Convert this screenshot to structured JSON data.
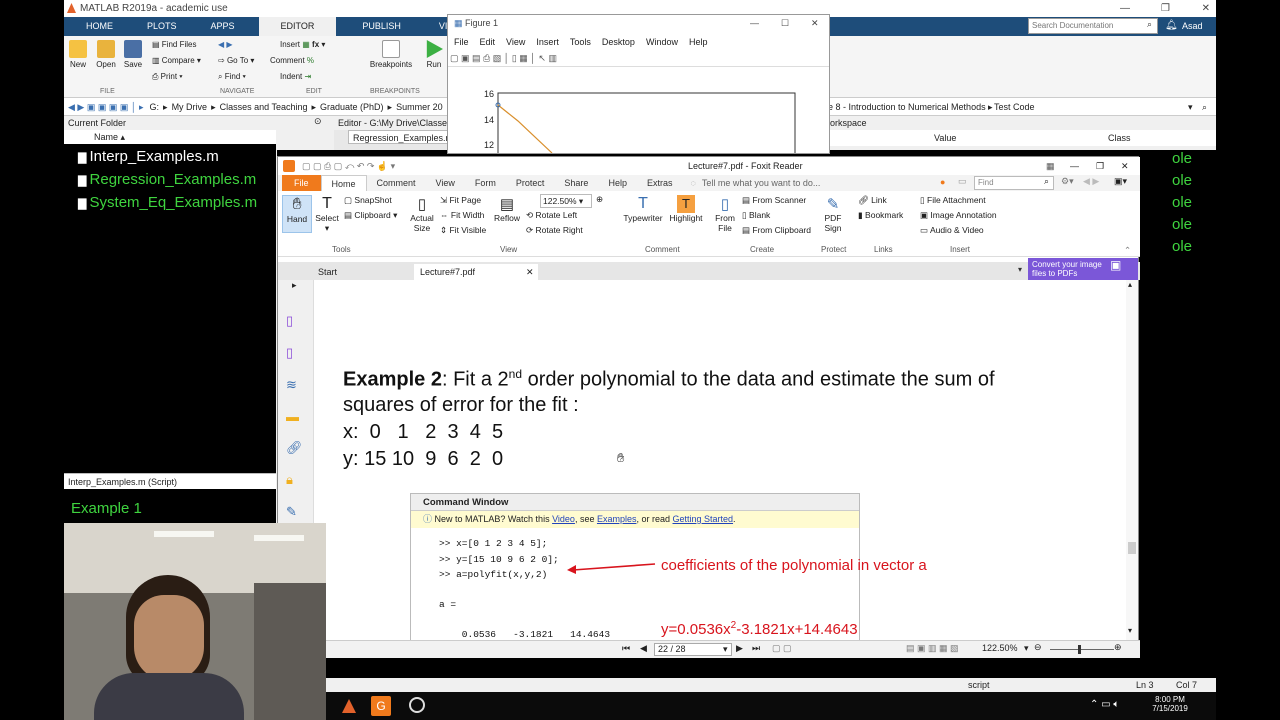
{
  "matlab": {
    "title": "MATLAB R2019a - academic use",
    "tabs": [
      "HOME",
      "PLOTS",
      "APPS",
      "EDITOR",
      "PUBLISH",
      "VIEW"
    ],
    "ribbon": {
      "new": "New",
      "open": "Open",
      "save": "Save",
      "find_files": "Find Files",
      "compare": "Compare",
      "print": "Print",
      "go_to": "Go To",
      "find": "Find",
      "insert": "Insert",
      "comment": "Comment",
      "indent": "Indent",
      "fx": "fx",
      "breakpoints": "Breakpoints",
      "run": "Run",
      "group_file": "FILE",
      "group_navigate": "NAVIGATE",
      "group_edit": "EDIT",
      "group_breakpoints": "BREAKPOINTS"
    },
    "search_placeholder": "Search Documentation",
    "user": "Asad",
    "address": [
      "G:",
      "My Drive",
      "Classes and Teaching",
      "Graduate (PhD)",
      "Summer 20"
    ],
    "address_right": [
      "e 8 - Introduction to Numerical Methods",
      "Test Code"
    ],
    "current_folder": {
      "title": "Current Folder",
      "col_name": "Name ▴",
      "files": [
        "Interp_Examples.m",
        "Regression_Examples.m",
        "System_Eq_Examples.m"
      ]
    },
    "status_file": "Interp_Examples.m  (Script)",
    "example_label": "Example 1",
    "editor": {
      "title": "Editor - G:\\My Drive\\Classe",
      "tab": "Regression_Examples.m"
    },
    "workspace": {
      "title": "orkspace",
      "col_value": "Value",
      "col_class": "Class"
    },
    "right_text": [
      "ole",
      "ole",
      "ole",
      "ole",
      "ole"
    ],
    "statusbar": {
      "mode": "script",
      "ln": "Ln  3",
      "col": "Col  7"
    }
  },
  "taskbar": {
    "time": "8:00 PM",
    "date": "7/15/2019"
  },
  "figure": {
    "title": "Figure 1",
    "menu": [
      "File",
      "Edit",
      "View",
      "Insert",
      "Tools",
      "Desktop",
      "Window",
      "Help"
    ],
    "yticks": [
      "16",
      "14",
      "12"
    ]
  },
  "foxit": {
    "title": "Lecture#7.pdf - Foxit Reader",
    "tabs": [
      "File",
      "Home",
      "Comment",
      "View",
      "Form",
      "Protect",
      "Share",
      "Help",
      "Extras"
    ],
    "tell": "Tell me what you want to do...",
    "find_placeholder": "Find",
    "ribbon": {
      "hand": "Hand",
      "select": "Select",
      "snapshot": "SnapShot",
      "clipboard": "Clipboard",
      "actual_size": "Actual Size",
      "fit_page": "Fit Page",
      "fit_width": "Fit Width",
      "fit_visible": "Fit Visible",
      "reflow": "Reflow",
      "zoom": "122.50%",
      "rotate_left": "Rotate Left",
      "rotate_right": "Rotate Right",
      "typewriter": "Typewriter",
      "highlight": "Highlight",
      "from_file": "From File",
      "from_scanner": "From Scanner",
      "blank": "Blank",
      "from_clipboard": "From Clipboard",
      "pdf_sign": "PDF Sign",
      "link": "Link",
      "bookmark": "Bookmark",
      "file_attachment": "File Attachment",
      "image_annotation": "Image Annotation",
      "audio_video": "Audio & Video",
      "groups": [
        "Tools",
        "View",
        "Comment",
        "Create",
        "Protect",
        "Links",
        "Insert"
      ]
    },
    "promo": "Convert your image files to PDFs",
    "doc_tabs": [
      "Start",
      "Lecture#7.pdf"
    ],
    "page_nav": "22 / 28",
    "zoom_status": "122.50%",
    "doc": {
      "line1_bold": "Example 2",
      "line1_a": ": Fit a 2",
      "line1_sup": "nd",
      "line1_b": " order polynomial to the data and estimate the sum of",
      "line2": "squares of error for the fit :",
      "line3": "x:  0   1   2  3  4  5",
      "line4": "y: 15 10  9  6  2  0",
      "cmd": {
        "title": "Command Window",
        "info_prefix": "New to MATLAB? Watch this ",
        "video": "Video",
        "info_mid": ", see ",
        "examples": "Examples",
        "info_mid2": ", or read ",
        "getting_started": "Getting Started",
        "info_end": ".",
        "lines": [
          ">> x=[0 1 2 3 4 5];",
          ">> y=[15 10 9 6 2 0];",
          ">> a=polyfit(x,y,2)"
        ],
        "a_eq": "a =",
        "values": "    0.0536   -3.1821   14.4643"
      },
      "annot1": "coefficients of the polynomial in vector a",
      "annot2_a": "y=0.0536x",
      "annot2_sup": "2",
      "annot2_b": "-3.1821x+14.4643"
    }
  },
  "colors": {
    "matlab_blue": "#1e4d7a",
    "foxit_orange": "#f07a1c",
    "green_text": "#3fd43f",
    "annot_red": "#d8141d"
  }
}
